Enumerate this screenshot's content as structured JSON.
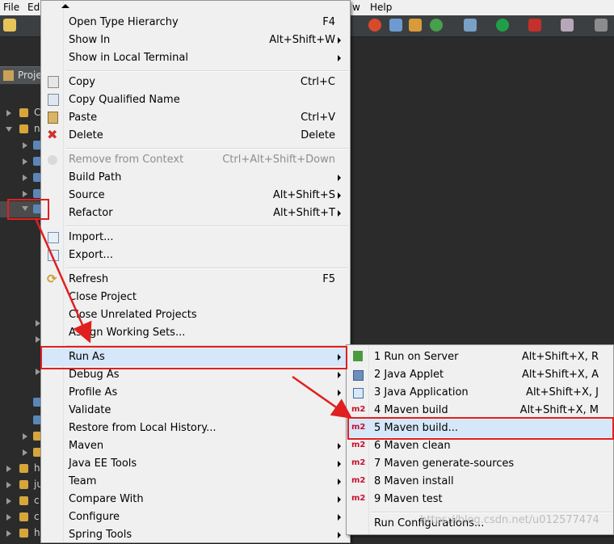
{
  "menubar": {
    "file": "File",
    "edit": "Ed",
    "help": "Help",
    "window_frag": "w"
  },
  "explorer": {
    "tab_label": "Proje"
  },
  "tree": {
    "row_labels": [
      "C",
      "n",
      "h",
      "ju",
      "c",
      "c",
      "h"
    ]
  },
  "context_menu": {
    "items": [
      {
        "label": "Open Type Hierarchy",
        "shortcut": "F4"
      },
      {
        "label": "Show In",
        "shortcut": "Alt+Shift+W"
      },
      {
        "label": "Show in Local Terminal",
        "shortcut": ""
      },
      {
        "label": "Copy",
        "shortcut": "Ctrl+C"
      },
      {
        "label": "Copy Qualified Name",
        "shortcut": ""
      },
      {
        "label": "Paste",
        "shortcut": "Ctrl+V"
      },
      {
        "label": "Delete",
        "shortcut": "Delete"
      },
      {
        "label": "Remove from Context",
        "shortcut": "Ctrl+Alt+Shift+Down"
      },
      {
        "label": "Build Path",
        "shortcut": ""
      },
      {
        "label": "Source",
        "shortcut": "Alt+Shift+S"
      },
      {
        "label": "Refactor",
        "shortcut": "Alt+Shift+T"
      },
      {
        "label": "Import...",
        "shortcut": ""
      },
      {
        "label": "Export...",
        "shortcut": ""
      },
      {
        "label": "Refresh",
        "shortcut": "F5"
      },
      {
        "label": "Close Project",
        "shortcut": ""
      },
      {
        "label": "Close Unrelated Projects",
        "shortcut": ""
      },
      {
        "label": "Assign Working Sets...",
        "shortcut": ""
      },
      {
        "label": "Run As",
        "shortcut": ""
      },
      {
        "label": "Debug As",
        "shortcut": ""
      },
      {
        "label": "Profile As",
        "shortcut": ""
      },
      {
        "label": "Validate",
        "shortcut": ""
      },
      {
        "label": "Restore from Local History...",
        "shortcut": ""
      },
      {
        "label": "Maven",
        "shortcut": ""
      },
      {
        "label": "Java EE Tools",
        "shortcut": ""
      },
      {
        "label": "Team",
        "shortcut": ""
      },
      {
        "label": "Compare With",
        "shortcut": ""
      },
      {
        "label": "Configure",
        "shortcut": ""
      },
      {
        "label": "Spring Tools",
        "shortcut": ""
      }
    ]
  },
  "run_as_menu": {
    "items": [
      {
        "label": "1 Run on Server",
        "shortcut": "Alt+Shift+X, R"
      },
      {
        "label": "2 Java Applet",
        "shortcut": "Alt+Shift+X, A"
      },
      {
        "label": "3 Java Application",
        "shortcut": "Alt+Shift+X, J"
      },
      {
        "label": "4 Maven build",
        "shortcut": "Alt+Shift+X, M"
      },
      {
        "label": "5 Maven build...",
        "shortcut": ""
      },
      {
        "label": "6 Maven clean",
        "shortcut": ""
      },
      {
        "label": "7 Maven generate-sources",
        "shortcut": ""
      },
      {
        "label": "8 Maven install",
        "shortcut": ""
      },
      {
        "label": "9 Maven test",
        "shortcut": ""
      },
      {
        "label": "Run Configurations...",
        "shortcut": ""
      }
    ],
    "m2_icon_text": "m2"
  },
  "watermark": "https://blog.csdn.net/u012577474",
  "colors": {
    "highlight_box": "#e02020",
    "menu_bg": "#f0f0f0",
    "maven_icon": "#c8102e"
  }
}
